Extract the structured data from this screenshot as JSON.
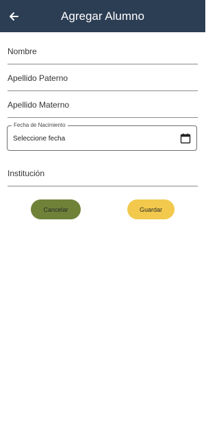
{
  "header": {
    "title": "Agregar Alumno",
    "back_icon": "arrow-left-icon"
  },
  "form": {
    "nombre_label": "Nombre",
    "apellido_paterno_label": "Apellido Paterno",
    "apellido_materno_label": "Apellido Materno",
    "fecha_nacimiento": {
      "label": "Fecha de Nacimiento",
      "value": "Seleccione fecha",
      "icon": "calendar-icon"
    },
    "institucion_label": "Institución"
  },
  "actions": {
    "cancel_label": "Cancelar",
    "save_label": "Guardar"
  },
  "colors": {
    "appbar": "#2c3e54",
    "cancel_button": "#6f8238",
    "save_button": "#f2c94c"
  }
}
